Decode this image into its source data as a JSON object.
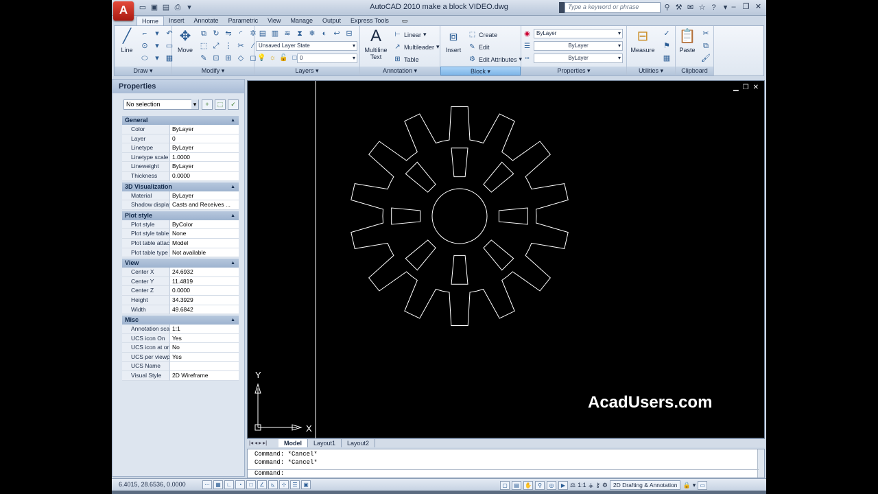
{
  "window": {
    "title": "AutoCAD 2010    make a block VIDEO.dwg",
    "search_placeholder": "Type a keyword or phrase",
    "logo_letter": "A"
  },
  "tabs": [
    "Home",
    "Insert",
    "Annotate",
    "Parametric",
    "View",
    "Manage",
    "Output",
    "Express Tools"
  ],
  "active_tab": "Home",
  "ribbon": {
    "draw": {
      "label": "Draw ▾",
      "line": "Line"
    },
    "modify": {
      "label": "Modify ▾",
      "move": "Move"
    },
    "layers": {
      "label": "Layers ▾",
      "layer_state": "Unsaved Layer State",
      "current_layer": "0"
    },
    "annotation": {
      "label": "Annotation ▾",
      "multiline_text_1": "Multiline",
      "multiline_text_2": "Text",
      "linear": "Linear",
      "multileader": "Multileader",
      "table": "Table"
    },
    "block": {
      "label": "Block ▾",
      "insert": "Insert",
      "create": "Create",
      "edit": "Edit",
      "edit_attributes": "Edit Attributes"
    },
    "properties": {
      "label": "Properties ▾",
      "color": "ByLayer",
      "lineweight": "ByLayer",
      "linetype": "ByLayer"
    },
    "utilities": {
      "label": "Utilities ▾",
      "measure": "Measure"
    },
    "clipboard": {
      "label": "Clipboard",
      "paste": "Paste"
    }
  },
  "properties_palette": {
    "title": "Properties",
    "selection": "No selection",
    "categories": [
      {
        "name": "General",
        "rows": [
          {
            "k": "Color",
            "v": "ByLayer"
          },
          {
            "k": "Layer",
            "v": "0"
          },
          {
            "k": "Linetype",
            "v": "ByLayer"
          },
          {
            "k": "Linetype scale",
            "v": "1.0000"
          },
          {
            "k": "Lineweight",
            "v": "ByLayer"
          },
          {
            "k": "Thickness",
            "v": "0.0000"
          }
        ]
      },
      {
        "name": "3D Visualization",
        "rows": [
          {
            "k": "Material",
            "v": "ByLayer"
          },
          {
            "k": "Shadow display",
            "v": "Casts and Receives ..."
          }
        ]
      },
      {
        "name": "Plot style",
        "rows": [
          {
            "k": "Plot style",
            "v": "ByColor"
          },
          {
            "k": "Plot style table",
            "v": "None"
          },
          {
            "k": "Plot table attac...",
            "v": "Model"
          },
          {
            "k": "Plot table type",
            "v": "Not available"
          }
        ]
      },
      {
        "name": "View",
        "rows": [
          {
            "k": "Center X",
            "v": "24.6932"
          },
          {
            "k": "Center Y",
            "v": "11.4819"
          },
          {
            "k": "Center Z",
            "v": "0.0000"
          },
          {
            "k": "Height",
            "v": "34.3929"
          },
          {
            "k": "Width",
            "v": "49.6842"
          }
        ]
      },
      {
        "name": "Misc",
        "rows": [
          {
            "k": "Annotation scale",
            "v": "1:1"
          },
          {
            "k": "UCS icon On",
            "v": "Yes"
          },
          {
            "k": "UCS icon at origin",
            "v": "No"
          },
          {
            "k": "UCS per viewport",
            "v": "Yes"
          },
          {
            "k": "UCS Name",
            "v": ""
          },
          {
            "k": "Visual Style",
            "v": "2D Wireframe"
          }
        ]
      }
    ]
  },
  "drawing": {
    "watermark": "AcadUsers.com",
    "ucs_x": "X",
    "ucs_y": "Y",
    "colors": {
      "background": "#000000",
      "lines": "#ffffff"
    }
  },
  "layout_tabs": [
    "Model",
    "Layout1",
    "Layout2"
  ],
  "active_layout": "Model",
  "command": {
    "history": [
      "Command: *Cancel*",
      "Command: *Cancel*"
    ],
    "prompt": "Command:"
  },
  "statusbar": {
    "coords": "6.4015, 28.6536, 0.0000",
    "anno_scale": "1:1",
    "workspace": "2D Drafting & Annotation"
  }
}
